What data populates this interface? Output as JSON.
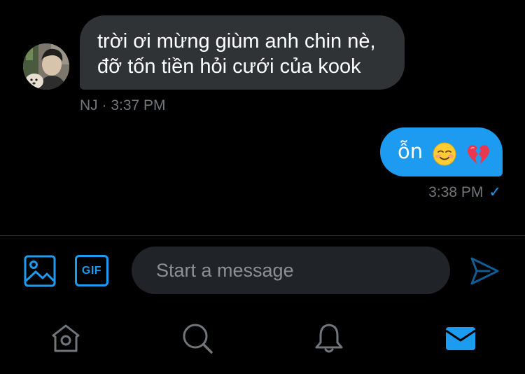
{
  "conversation": {
    "incoming": {
      "lines": [
        "trời ơi mừng giùm anh chin nè,",
        "đỡ tốn tiền hỏi cưới của kook"
      ],
      "meta": "NJ · 3:37 PM",
      "avatar_icon": "user-avatar-photo"
    },
    "outgoing": {
      "text": "ỗn",
      "emoji": [
        "smiling-face-emoji",
        "broken-heart-emoji"
      ],
      "meta": "3:38 PM",
      "status_glyph": "✓"
    }
  },
  "composer": {
    "image_icon": "image-icon",
    "gif_label": "GIF",
    "input": {
      "placeholder": "Start a message",
      "value": ""
    },
    "send_icon": "send-icon"
  },
  "bottom_nav": {
    "items": [
      {
        "icon": "home-icon",
        "active": false
      },
      {
        "icon": "search-icon",
        "active": false
      },
      {
        "icon": "notifications-icon",
        "active": false
      },
      {
        "icon": "messages-icon",
        "active": true
      }
    ]
  },
  "colors": {
    "background": "#000000",
    "incoming_bubble": "#2f3336",
    "outgoing_bubble": "#1d9bf0",
    "accent": "#1d9bf0",
    "meta_text": "#71767b",
    "nav_icon": "#71767b",
    "input_background": "#202327"
  }
}
